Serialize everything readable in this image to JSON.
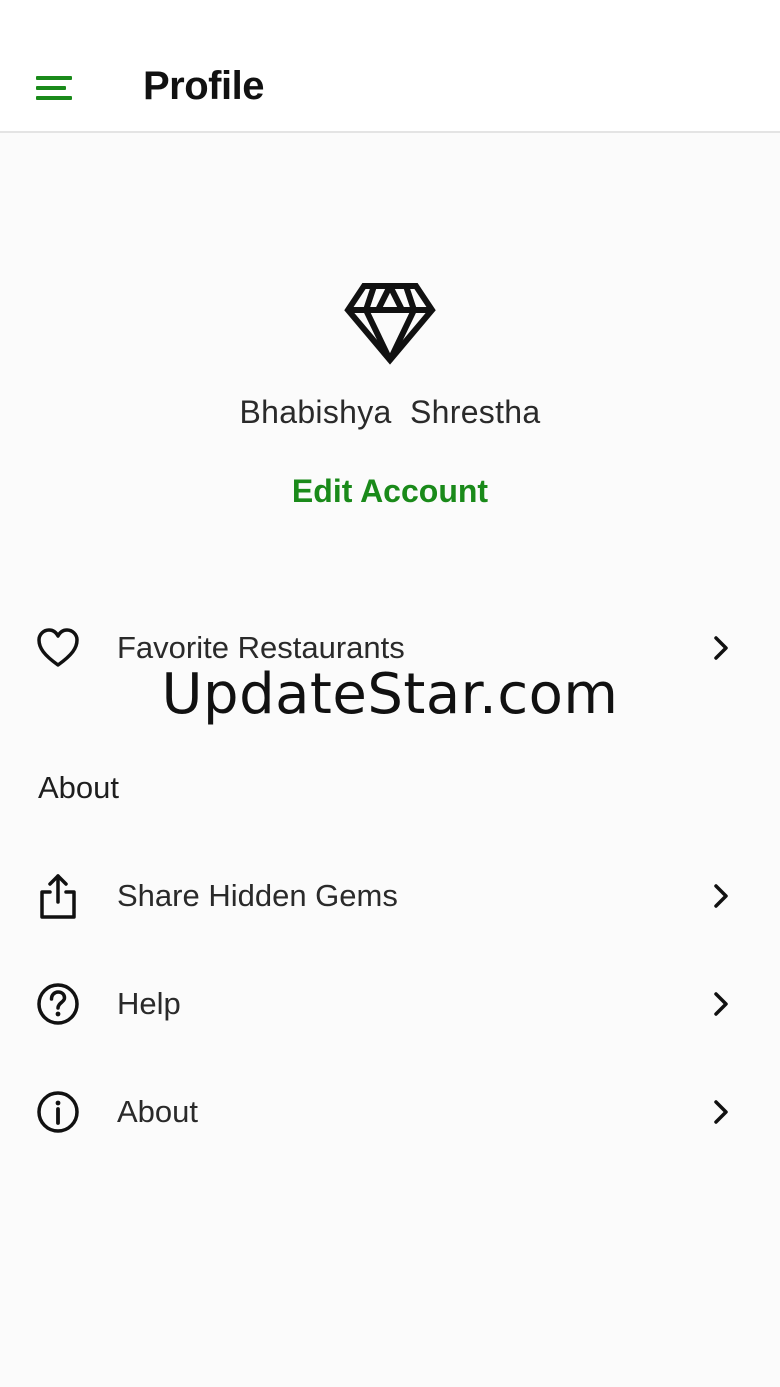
{
  "header": {
    "title": "Profile",
    "menu_icon": "hamburger-menu-icon",
    "accent_color": "#1a8a1a"
  },
  "profile": {
    "avatar_icon": "diamond-icon",
    "name": "Bhabishya  Shrestha",
    "edit_label": "Edit Account"
  },
  "favorites": {
    "label": "Favorite Restaurants",
    "icon": "heart-icon"
  },
  "about_section": {
    "title": "About",
    "items": [
      {
        "label": "Share Hidden Gems",
        "icon": "share-icon"
      },
      {
        "label": "Help",
        "icon": "help-circle-icon"
      },
      {
        "label": "About",
        "icon": "info-circle-icon"
      }
    ]
  },
  "watermark": "UpdateStar.com"
}
